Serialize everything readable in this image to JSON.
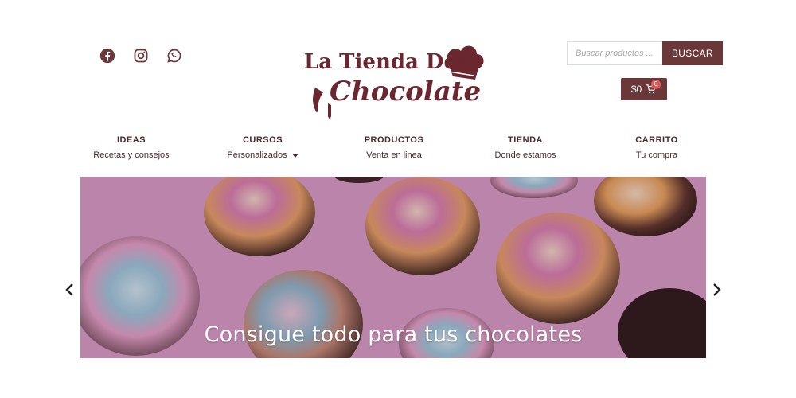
{
  "social": {
    "icons": [
      "facebook-icon",
      "instagram-icon",
      "whatsapp-icon"
    ],
    "color": "#6a3838"
  },
  "logo": {
    "line1": "La Tienda Del",
    "line2": "Chocolate",
    "color": "#6a2730"
  },
  "search": {
    "placeholder": "Buscar productos ...",
    "button_label": "BUSCAR"
  },
  "cart": {
    "total": "$0",
    "count": "0",
    "icon": "shopping-cart-icon"
  },
  "nav": {
    "items": [
      {
        "title": "IDEAS",
        "subtitle": "Recetas y consejos"
      },
      {
        "title": "CURSOS",
        "subtitle": "Personalizados"
      },
      {
        "title": "PRODUCTOS",
        "subtitle": "Venta en linea"
      },
      {
        "title": "TIENDA",
        "subtitle": "Donde estamos"
      },
      {
        "title": "CARRITO",
        "subtitle": "Tu compra"
      }
    ]
  },
  "hero": {
    "caption": "Consigue todo para tus chocolates",
    "prev_icon": "chevron-left-icon",
    "next_icon": "chevron-right-icon"
  },
  "colors": {
    "brand": "#6a3838",
    "badge": "#e05a5a",
    "hero_bg": "#d59ac3"
  }
}
